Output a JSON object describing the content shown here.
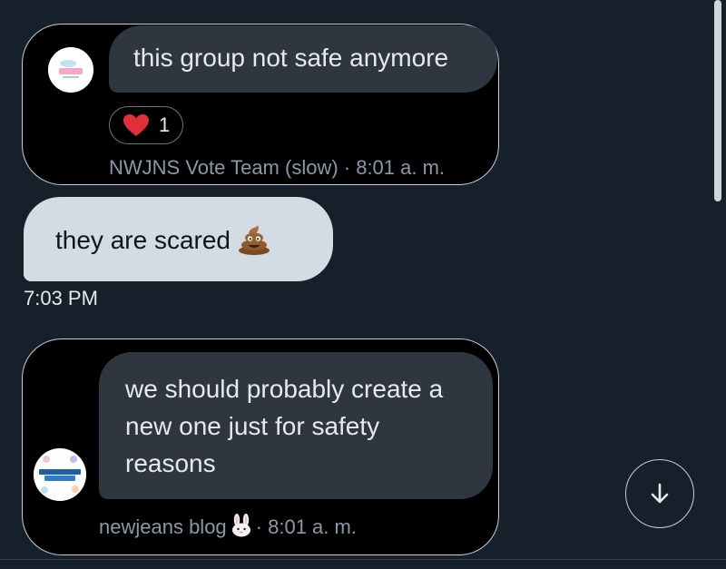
{
  "colors": {
    "background": "#15202b",
    "card": "#000000",
    "quote_bubble": "#2f3640",
    "own_bubble": "#d3dbe3",
    "meta_text": "#8b98a5"
  },
  "messages": [
    {
      "quoted_text": "this group not safe anymore",
      "avatar_icon": "nwjns-vote-team-logo",
      "reaction": {
        "icon": "red-heart-icon",
        "count": "1"
      },
      "meta": "NWJNS Vote Team (slow) · 8:01 a. m."
    },
    {
      "text": "they are scared",
      "emoji": "pile-of-poo-icon",
      "time": "7:03 PM"
    },
    {
      "quoted_text": "we should probably create a new one just for safety reasons",
      "avatar_icon": "newjeans-team-logo",
      "meta_name": "newjeans blog",
      "meta_emoji": "rabbit-face-icon",
      "meta_time": "· 8:01 a. m."
    }
  ],
  "scroll_button": {
    "icon": "arrow-down-icon"
  }
}
